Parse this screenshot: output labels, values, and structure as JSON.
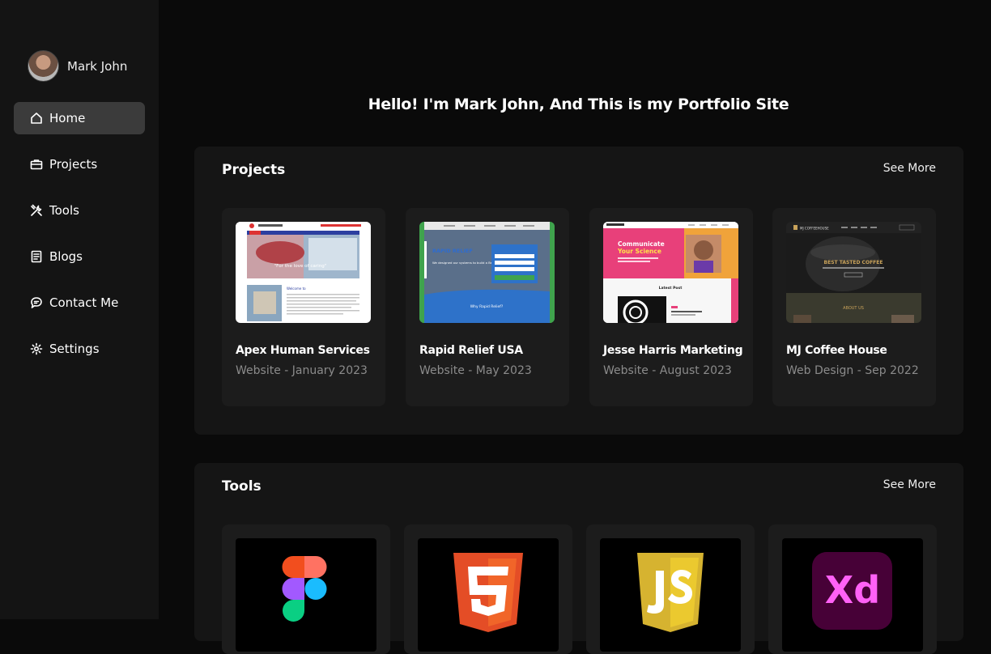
{
  "profile": {
    "name": "Mark John"
  },
  "nav": [
    {
      "label": "Home",
      "icon": "home-icon"
    },
    {
      "label": "Projects",
      "icon": "briefcase-icon"
    },
    {
      "label": "Tools",
      "icon": "tools-icon"
    },
    {
      "label": "Blogs",
      "icon": "document-icon"
    },
    {
      "label": "Contact Me",
      "icon": "chat-icon"
    },
    {
      "label": "Settings",
      "icon": "gear-icon"
    }
  ],
  "headline": "Hello! I'm Mark John, And This is my Portfolio Site",
  "projects": {
    "title": "Projects",
    "see_more": "See More",
    "items": [
      {
        "title": "Apex Human Services",
        "subtitle": "Website - January 2023"
      },
      {
        "title": "Rapid Relief USA",
        "subtitle": "Website - May 2023"
      },
      {
        "title": "Jesse Harris Marketing",
        "subtitle": "Website - August 2023"
      },
      {
        "title": "MJ Coffee House",
        "subtitle": "Web Design - Sep 2022"
      }
    ],
    "thumb_text": {
      "apex_tagline": "\"For the love of caring\"",
      "apex_welcome": "Welcome to",
      "rapid_logo": "RAPID RELIEF",
      "rapid_heading": "We designed our systems to build a Better You.",
      "rapid_cta": "Why Rapid Relief?",
      "jesse_line1": "Communicate",
      "jesse_line2": "Your Science",
      "jesse_latest": "Latest Post",
      "coffee_brand": "MJ COFFEEHOUSE",
      "coffee_tagline": "BEST TASTED COFFEE",
      "coffee_about": "ABOUT US"
    }
  },
  "tools": {
    "title": "Tools",
    "see_more": "See More",
    "items": [
      {
        "name": "Figma",
        "icon": "figma-icon"
      },
      {
        "name": "HTML5",
        "icon": "html5-icon"
      },
      {
        "name": "JavaScript",
        "icon": "javascript-icon"
      },
      {
        "name": "Adobe XD",
        "icon": "adobe-xd-icon",
        "logo_text": "Xd"
      }
    ]
  },
  "colors": {
    "background": "#0a0a0a",
    "sidebar": "#141414",
    "panel": "#151515",
    "card": "#1c1c1c",
    "active_nav": "#3b3b3b",
    "muted_text": "#8b8b8b"
  }
}
